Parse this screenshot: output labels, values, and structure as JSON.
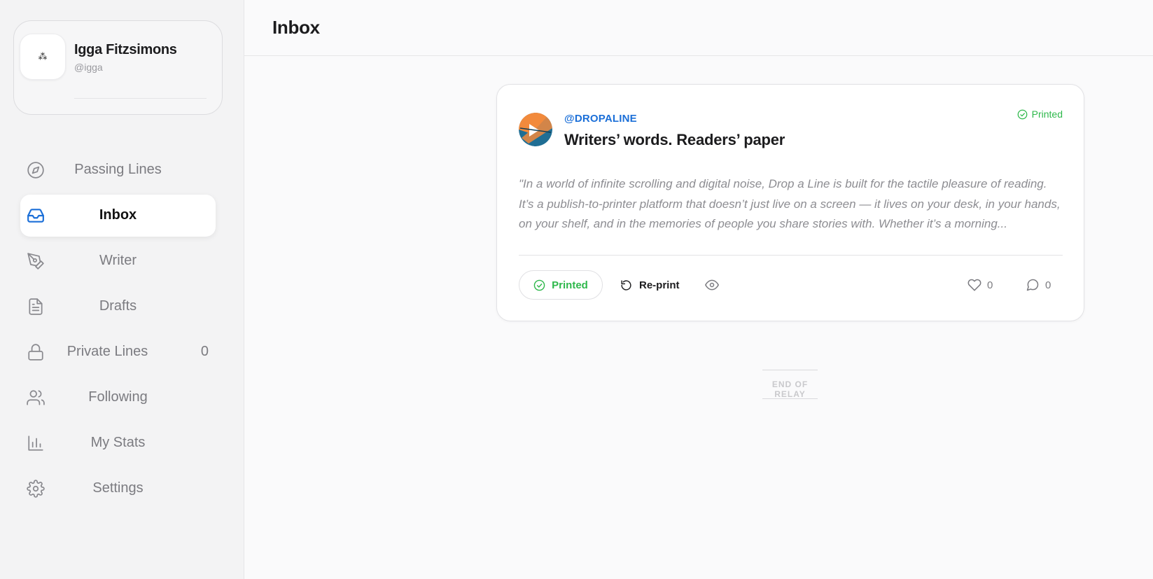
{
  "profile": {
    "name": "Igga Fitzsimons",
    "handle": "@igga",
    "avatar_glyph": "⁂"
  },
  "nav": {
    "items": [
      {
        "label": "Passing Lines",
        "icon": "compass-icon",
        "active": false
      },
      {
        "label": "Inbox",
        "icon": "inbox-icon",
        "active": true
      },
      {
        "label": "Writer",
        "icon": "pen-icon",
        "active": false
      },
      {
        "label": "Drafts",
        "icon": "document-icon",
        "active": false
      },
      {
        "label": "Private Lines",
        "icon": "lock-icon",
        "active": false,
        "count": "0"
      },
      {
        "label": "Following",
        "icon": "users-icon",
        "active": false
      },
      {
        "label": "My Stats",
        "icon": "bar-chart-icon",
        "active": false
      },
      {
        "label": "Settings",
        "icon": "gear-icon",
        "active": false
      }
    ]
  },
  "header": {
    "title": "Inbox"
  },
  "feed": {
    "posts": [
      {
        "author": "@DROPALINE",
        "title": "Writers’ words. Readers’ paper",
        "status": "Printed",
        "excerpt": "\"In a world of infinite scrolling and digital noise, Drop a Line is built for the tactile pleasure of reading. It’s a publish-to-printer platform that doesn’t just live on a screen — it lives on your desk, in your hands, on your shelf, and in the memories of people you share stories with. Whether it’s a morning...",
        "printed_label": "Printed",
        "reprint_label": "Re-print",
        "likes": "0",
        "comments": "0"
      }
    ],
    "end_label": "END OF RELAY"
  },
  "colors": {
    "accent_blue": "#1b6fd8",
    "success_green": "#2eb84b",
    "muted_text": "#7b7b80",
    "avatar_orange": "#f28a3c",
    "avatar_teal": "#1f6e94"
  }
}
